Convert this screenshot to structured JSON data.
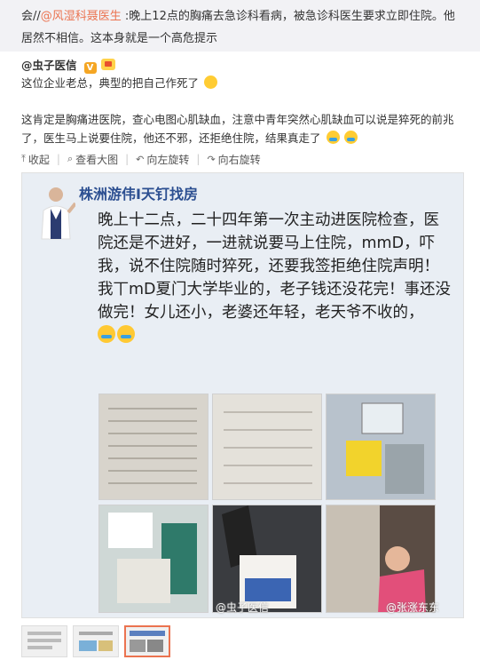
{
  "top": {
    "prefix": "会//",
    "mention": "@风湿科聂医生",
    "text": " :晚上12点的胸痛去急诊科看病，被急诊科医生要求立即住院。他居然不相信。这本身就是一个高危提示"
  },
  "repost": {
    "author": "@虫子医信",
    "v_badge": "V",
    "line": "这位企业老总，典型的把自己作死了"
  },
  "body": {
    "text": "这肯定是胸痛进医院，查心电图心肌缺血，注意中青年突然心肌缺血可以说是猝死的前兆了，医生马上说要住院，他还不邪，还拒绝住院，结果真走了"
  },
  "toolbar": {
    "collapse": "收起",
    "view_large": "查看大图",
    "rotate_left": "向左旋转",
    "rotate_right": "向右旋转"
  },
  "image": {
    "header": "株洲游伟I天钉找房",
    "post": "晚上十二点，二十四年第一次主动进医院检查，医院还是不进好，一进就说要马上住院，mmD，吓我，说不住院随时猝死，还要我签拒绝住院声明！我丅mD夏门大学毕业的，老子钱还没花完！事还没做完！女儿还小，老婆还年轻，老天爷不收的，",
    "watermark_left": "@虫子医信",
    "watermark_right": "@张涨东东"
  },
  "colors": {
    "accent": "#eb7350",
    "header_blue": "#2c4f91"
  }
}
